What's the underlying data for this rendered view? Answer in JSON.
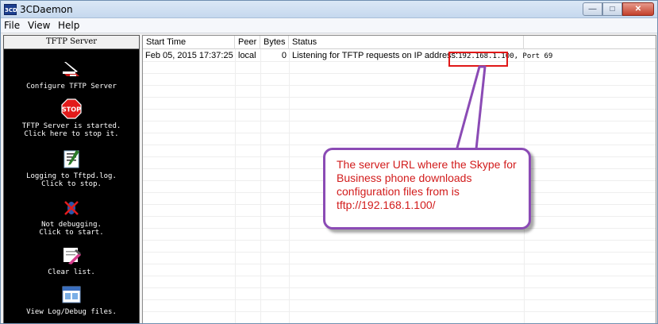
{
  "window": {
    "title": "3CDaemon",
    "icon_text": "3CD"
  },
  "window_controls": {
    "minimize": "—",
    "maximize": "□",
    "close": "✕"
  },
  "menu": {
    "items": [
      "File",
      "View",
      "Help"
    ]
  },
  "sidebar": {
    "header": "TFTP Server",
    "items": [
      {
        "icon": "configure-icon",
        "label": "Configure TFTP Server"
      },
      {
        "icon": "stop-icon",
        "label": "TFTP Server is started.\nClick here to stop it.",
        "stop_text": "STOP"
      },
      {
        "icon": "logging-icon",
        "label": "Logging to Tftpd.log.\nClick to stop."
      },
      {
        "icon": "debug-icon",
        "label": "Not debugging.\nClick to start."
      },
      {
        "icon": "clear-list-icon",
        "label": "Clear list."
      },
      {
        "icon": "view-log-icon",
        "label": "View Log/Debug files."
      }
    ]
  },
  "log_table": {
    "columns": [
      "Start Time",
      "Peer",
      "Bytes",
      "Status"
    ],
    "rows": [
      {
        "start_time": "Feb 05, 2015 17:37:25",
        "peer": "local",
        "bytes": "0",
        "status_prefix": "Listening for TFTP requests on IP address:",
        "status_ip": "192.168.1.100",
        "status_suffix": ", Port 69"
      }
    ]
  },
  "callout": {
    "text": "The server URL where the Skype for\nBusiness phone  downloads\nconfiguration files from is\ntftp://192.168.1.100/",
    "text_color": "#d21c1c",
    "border_color": "#8b4bb5"
  },
  "highlight_color": "#e01818"
}
